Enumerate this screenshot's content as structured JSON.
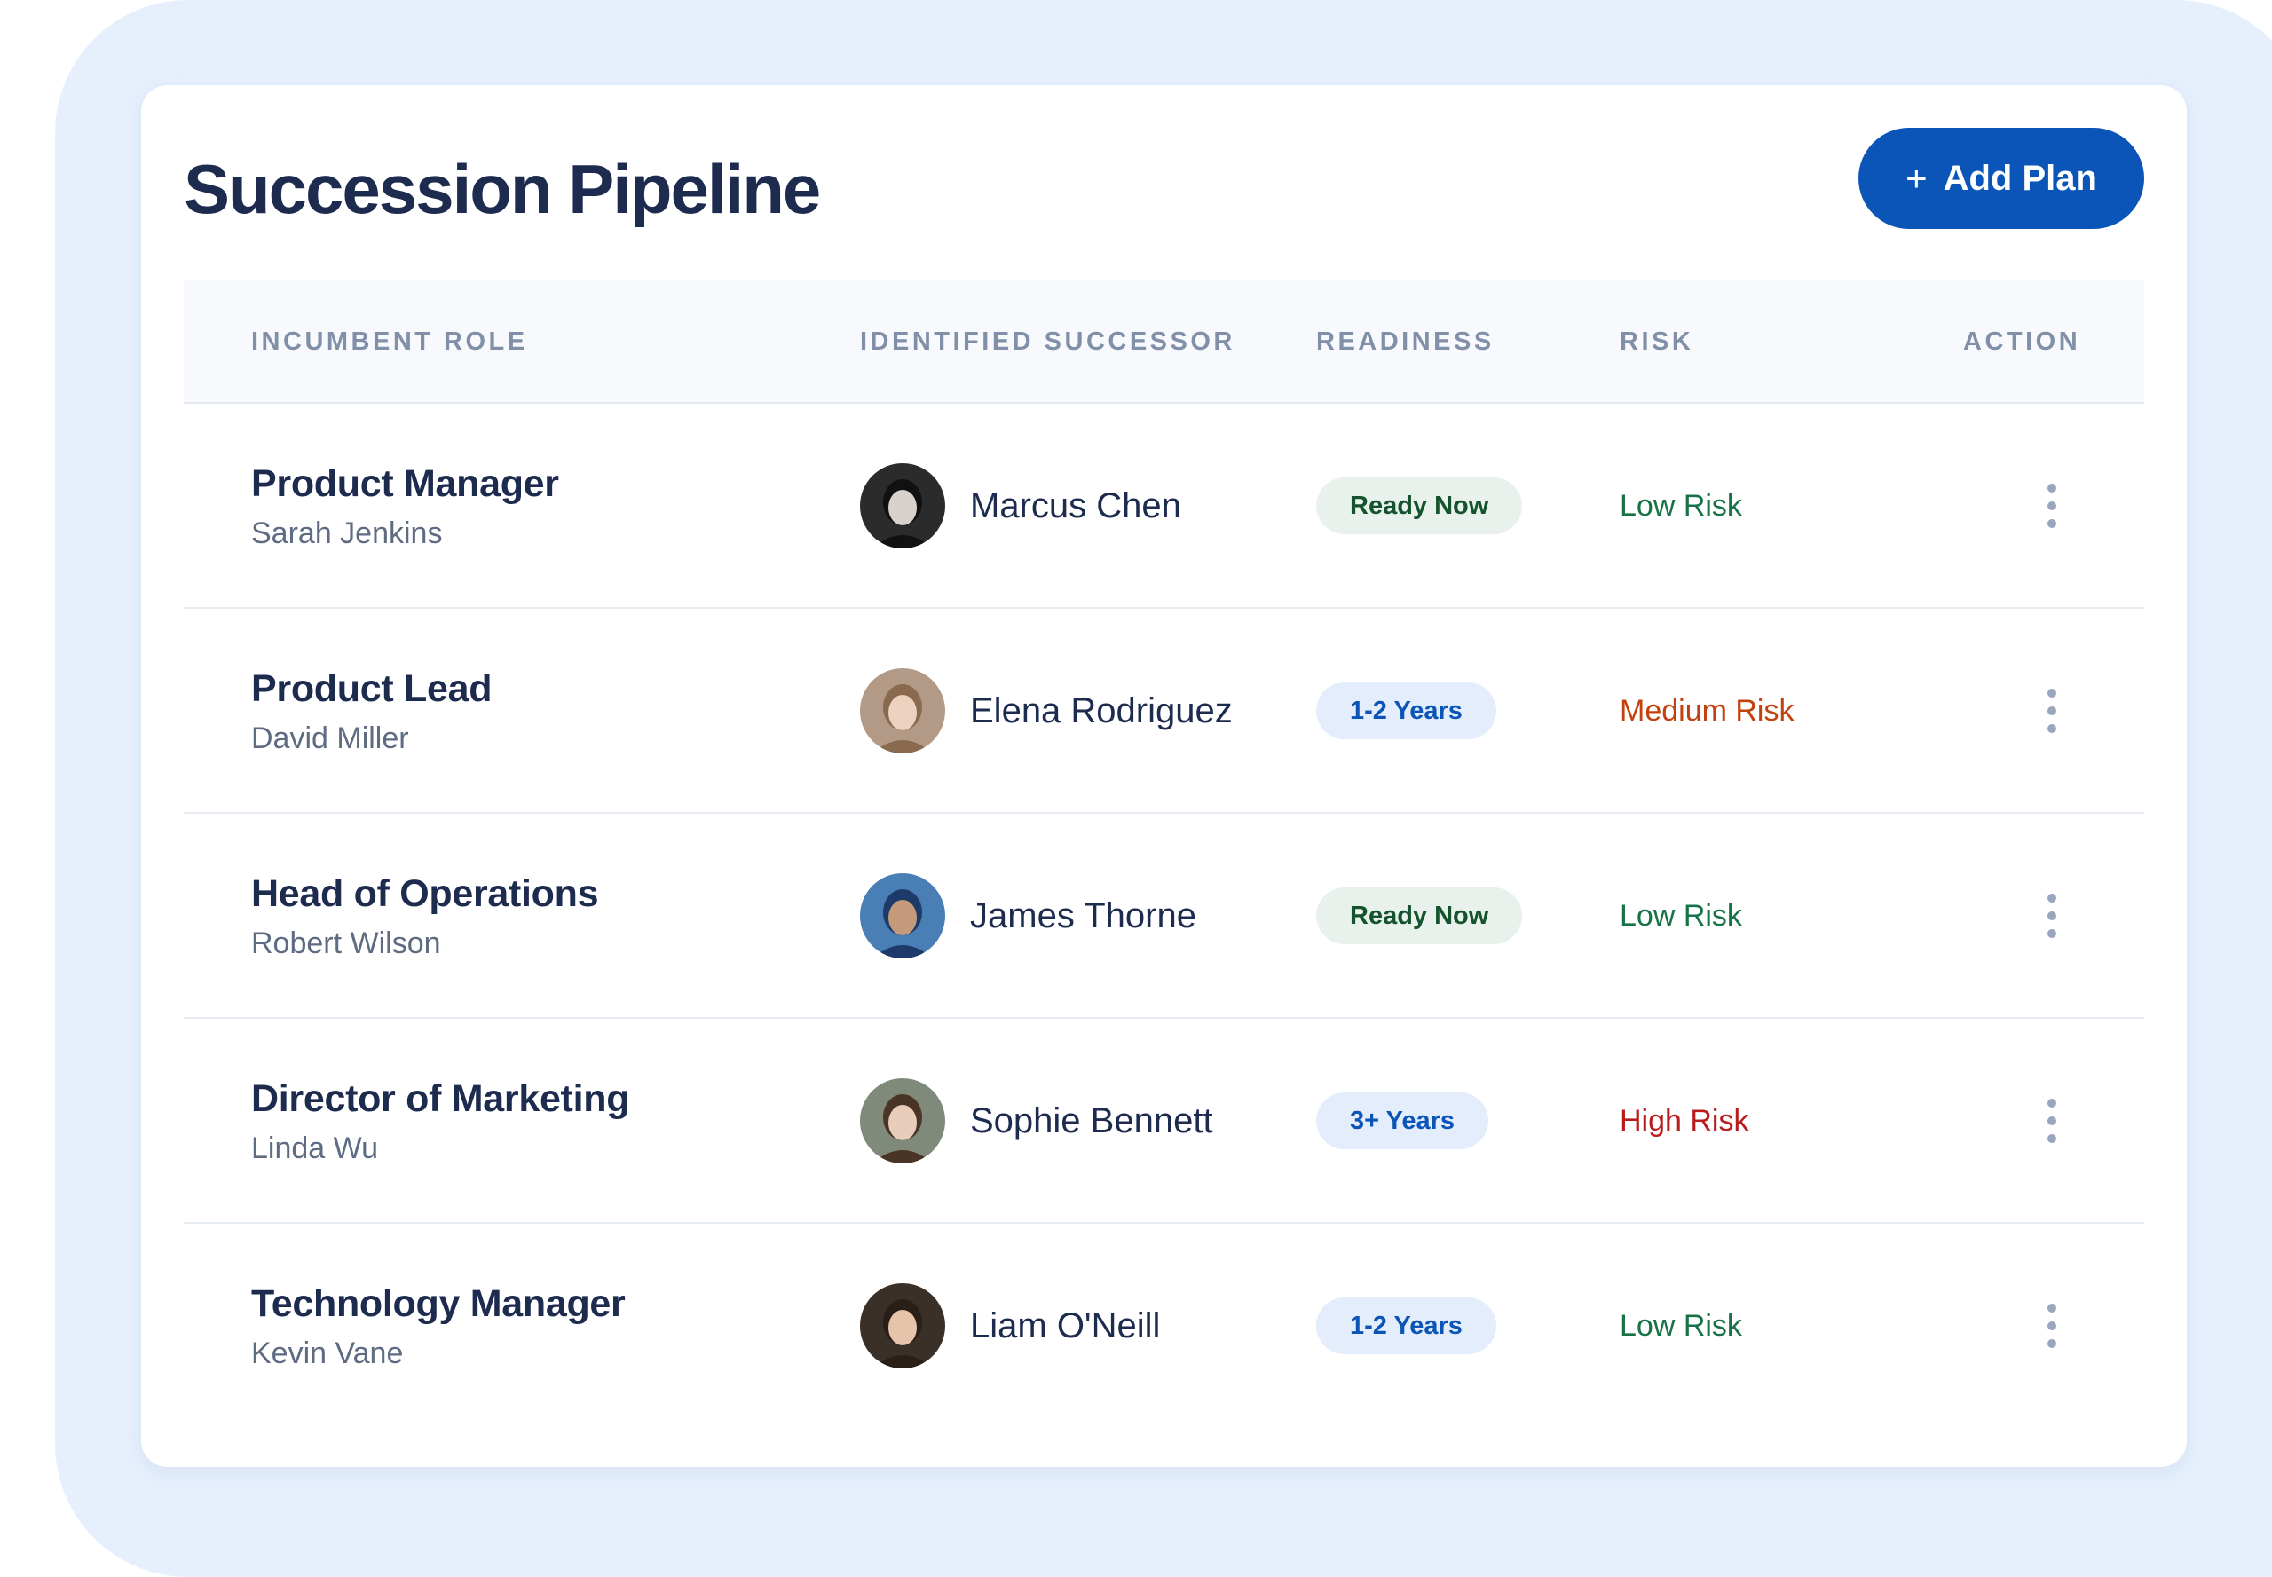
{
  "header": {
    "title": "Succession Pipeline",
    "add_button": {
      "icon": "plus-icon",
      "label": "Add Plan"
    }
  },
  "table": {
    "columns": [
      "INCUMBENT ROLE",
      "IDENTIFIED SUCCESSOR",
      "READINESS",
      "RISK",
      "ACTION"
    ],
    "rows": [
      {
        "role": "Product Manager",
        "incumbent": "Sarah Jenkins",
        "successor": "Marcus Chen",
        "readiness": "Ready Now",
        "readiness_type": "ready",
        "risk": "Low Risk",
        "risk_level": "low",
        "action_icon": "more-vertical-icon"
      },
      {
        "role": "Product Lead",
        "incumbent": "David Miller",
        "successor": "Elena Rodriguez",
        "readiness": "1-2 Years",
        "readiness_type": "years",
        "risk": "Medium Risk",
        "risk_level": "medium",
        "action_icon": "more-vertical-icon"
      },
      {
        "role": "Head of Operations",
        "incumbent": "Robert Wilson",
        "successor": "James Thorne",
        "readiness": "Ready Now",
        "readiness_type": "ready",
        "risk": "Low Risk",
        "risk_level": "low",
        "action_icon": "more-vertical-icon"
      },
      {
        "role": "Director of Marketing",
        "incumbent": "Linda Wu",
        "successor": "Sophie Bennett",
        "readiness": "3+ Years",
        "readiness_type": "years",
        "risk": "High Risk",
        "risk_level": "high",
        "action_icon": "more-vertical-icon"
      },
      {
        "role": "Technology Manager",
        "incumbent": "Kevin Vane",
        "successor": "Liam O'Neill",
        "readiness": "1-2 Years",
        "readiness_type": "years",
        "risk": "Low Risk",
        "risk_level": "low",
        "action_icon": "more-vertical-icon"
      }
    ]
  },
  "colors": {
    "accent": "#0a55b7",
    "title": "#1d2b4f",
    "risk_low": "#177245",
    "risk_medium": "#c2410c",
    "risk_high": "#b91c1c",
    "badge_ready_bg": "#e9f1ec",
    "badge_years_bg": "#e3edfb"
  }
}
